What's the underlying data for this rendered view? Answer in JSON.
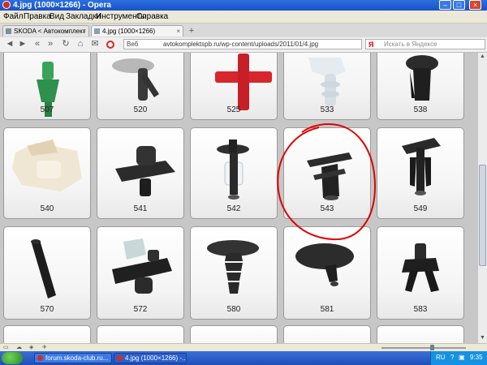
{
  "window": {
    "title": "4.jpg (1000×1266) - Opera",
    "min": "–",
    "max": "□",
    "close": "×"
  },
  "menu": [
    "Файл",
    "Правка",
    "Вид",
    "Закладки",
    "Инструменты",
    "Справка"
  ],
  "tabs": [
    {
      "label": "SKODA < Автокомплект",
      "close": "×"
    },
    {
      "label": "4.jpg (1000×1266)",
      "close": "×"
    }
  ],
  "nav": {
    "back": "◄",
    "forward": "►",
    "reload": "↻",
    "home": "⌂",
    "web_label": "Веб",
    "url": "avtokomplektspb.ru/wp-content/uploads/2011/01/4.jpg",
    "search_logo": "Я",
    "search_placeholder": "Искать в Яндексе"
  },
  "parts": {
    "row1": [
      "507",
      "520",
      "525",
      "533",
      "538"
    ],
    "row2": [
      "540",
      "541",
      "542",
      "543",
      "549"
    ],
    "row3": [
      "570",
      "572",
      "580",
      "581",
      "583"
    ]
  },
  "annotation": {
    "highlighted_part": "543",
    "color": "#e00000"
  },
  "taskbar": {
    "items": [
      {
        "label": "forum.skoda-club.ru..."
      },
      {
        "label": "4.jpg (1000×1266) -..."
      }
    ],
    "lang": "RU",
    "time": "9:35"
  }
}
